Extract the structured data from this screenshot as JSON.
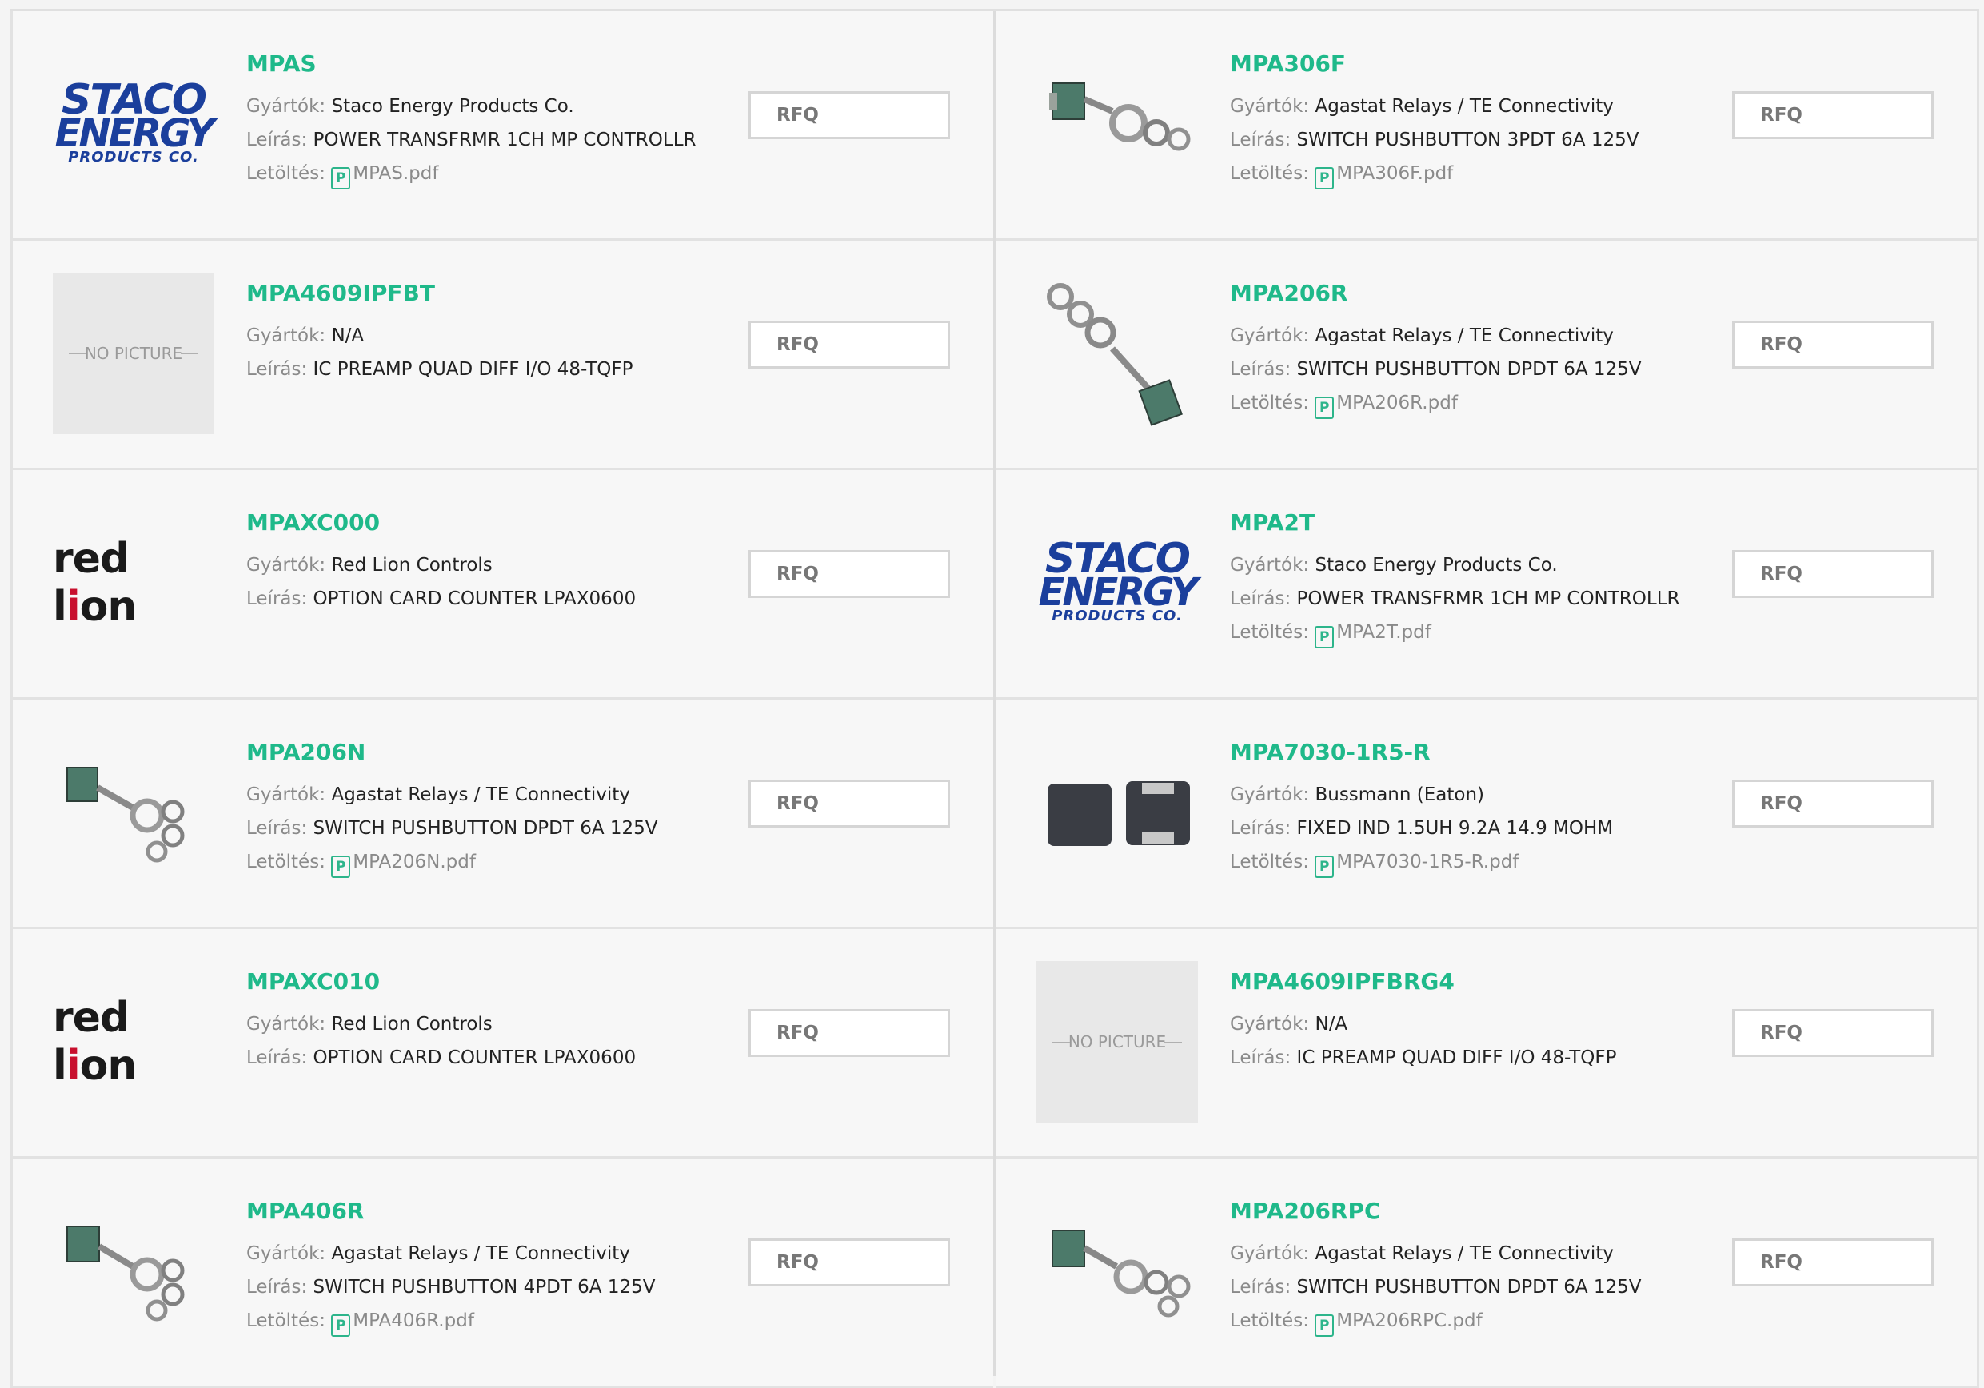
{
  "labels": {
    "manufacturer": "Gyártók:",
    "description": "Leírás:",
    "download": "Letöltés:",
    "rfq": "RFQ",
    "pdf_icon": "P",
    "no_picture": "NO PICTURE"
  },
  "logos": {
    "staco_line1": "STACO",
    "staco_line2": "ENERGY",
    "staco_line3": "PRODUCTS CO.",
    "redlion_a": "red l",
    "redlion_b": "i",
    "redlion_c": "on"
  },
  "colors": {
    "title_green": "#1fb98a",
    "staco_blue": "#1b3f9c",
    "redlion_red": "#c8102e"
  },
  "products": [
    {
      "part": "MPAS",
      "manufacturer": "Staco Energy Products Co.",
      "description": "POWER TRANSFRMR 1CH MP CONTROLLR",
      "pdf": "MPAS.pdf",
      "image": "staco-logo"
    },
    {
      "part": "MPA306F",
      "manufacturer": "Agastat Relays / TE Connectivity",
      "description": "SWITCH PUSHBUTTON 3PDT 6A 125V",
      "pdf": "MPA306F.pdf",
      "image": "pushbutton-switch-photo"
    },
    {
      "part": "MPA4609IPFBT",
      "manufacturer": "N/A",
      "description": "IC PREAMP QUAD DIFF I/O 48-TQFP",
      "pdf": null,
      "image": "no-picture"
    },
    {
      "part": "MPA206R",
      "manufacturer": "Agastat Relays / TE Connectivity",
      "description": "SWITCH PUSHBUTTON DPDT 6A 125V",
      "pdf": "MPA206R.pdf",
      "image": "pushbutton-switch-photo"
    },
    {
      "part": "MPAXC000",
      "manufacturer": "Red Lion Controls",
      "description": "OPTION CARD COUNTER LPAX0600",
      "pdf": null,
      "image": "redlion-logo"
    },
    {
      "part": "MPA2T",
      "manufacturer": "Staco Energy Products Co.",
      "description": "POWER TRANSFRMR 1CH MP CONTROLLR",
      "pdf": "MPA2T.pdf",
      "image": "staco-logo"
    },
    {
      "part": "MPA206N",
      "manufacturer": "Agastat Relays / TE Connectivity",
      "description": "SWITCH PUSHBUTTON DPDT 6A 125V",
      "pdf": "MPA206N.pdf",
      "image": "pushbutton-switch-photo"
    },
    {
      "part": "MPA7030-1R5-R",
      "manufacturer": "Bussmann (Eaton)",
      "description": "FIXED IND 1.5UH 9.2A 14.9 MOHM",
      "pdf": "MPA7030-1R5-R.pdf",
      "image": "inductor-photo"
    },
    {
      "part": "MPAXC010",
      "manufacturer": "Red Lion Controls",
      "description": "OPTION CARD COUNTER LPAX0600",
      "pdf": null,
      "image": "redlion-logo"
    },
    {
      "part": "MPA4609IPFBRG4",
      "manufacturer": "N/A",
      "description": "IC PREAMP QUAD DIFF I/O 48-TQFP",
      "pdf": null,
      "image": "no-picture"
    },
    {
      "part": "MPA406R",
      "manufacturer": "Agastat Relays / TE Connectivity",
      "description": "SWITCH PUSHBUTTON 4PDT 6A 125V",
      "pdf": "MPA406R.pdf",
      "image": "pushbutton-switch-photo"
    },
    {
      "part": "MPA206RPC",
      "manufacturer": "Agastat Relays / TE Connectivity",
      "description": "SWITCH PUSHBUTTON DPDT 6A 125V",
      "pdf": "MPA206RPC.pdf",
      "image": "pushbutton-switch-photo"
    }
  ]
}
